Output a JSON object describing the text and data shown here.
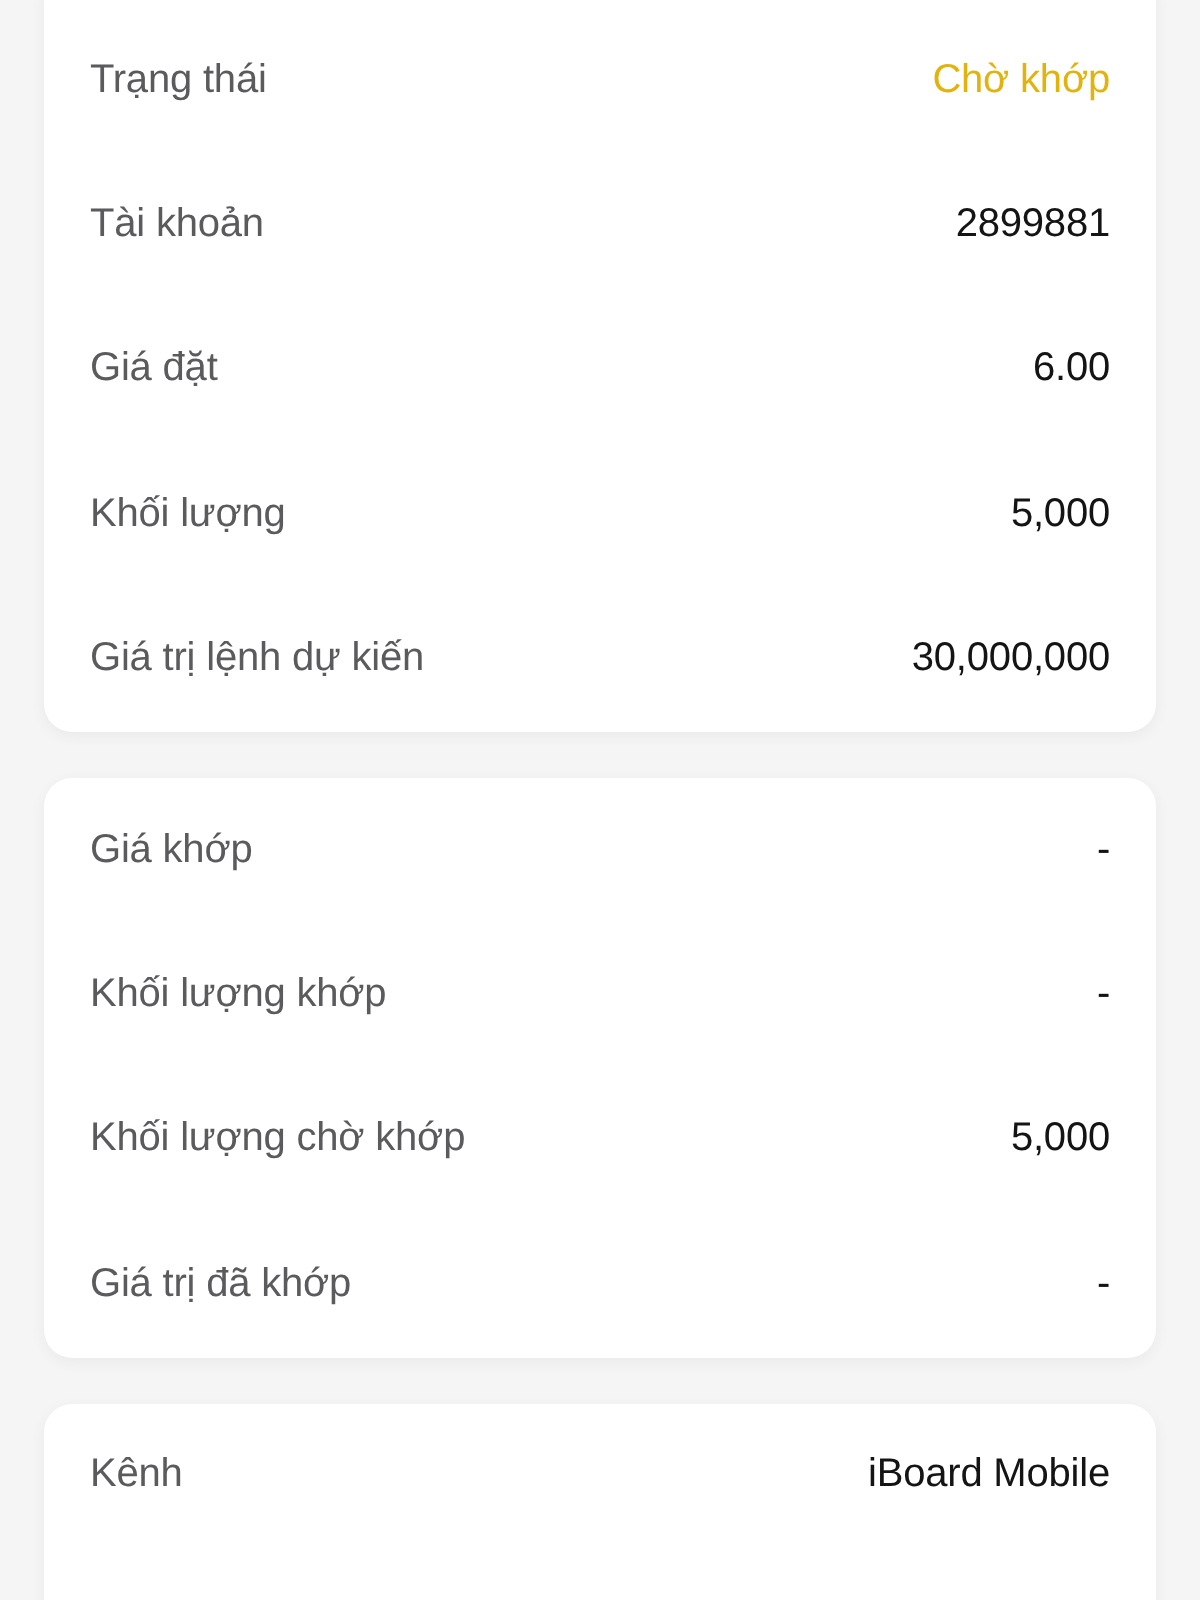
{
  "cards": [
    {
      "rows": [
        {
          "label": "Trạng thái",
          "value": "Chờ khớp",
          "color": "#e2b20f"
        },
        {
          "label": "Tài khoản",
          "value": "2899881"
        },
        {
          "label": "Giá đặt",
          "value": "6.00"
        },
        {
          "label": "Khối lượng",
          "value": "5,000"
        },
        {
          "label": "Giá trị lệnh dự kiến",
          "value": "30,000,000"
        }
      ]
    },
    {
      "rows": [
        {
          "label": "Giá khớp",
          "value": "-"
        },
        {
          "label": "Khối lượng khớp",
          "value": "-"
        },
        {
          "label": "Khối lượng chờ khớp",
          "value": "5,000"
        },
        {
          "label": "Giá trị đã khớp",
          "value": "-"
        }
      ]
    },
    {
      "rows": [
        {
          "label": "Kênh",
          "value": "iBoard Mobile"
        }
      ]
    }
  ]
}
